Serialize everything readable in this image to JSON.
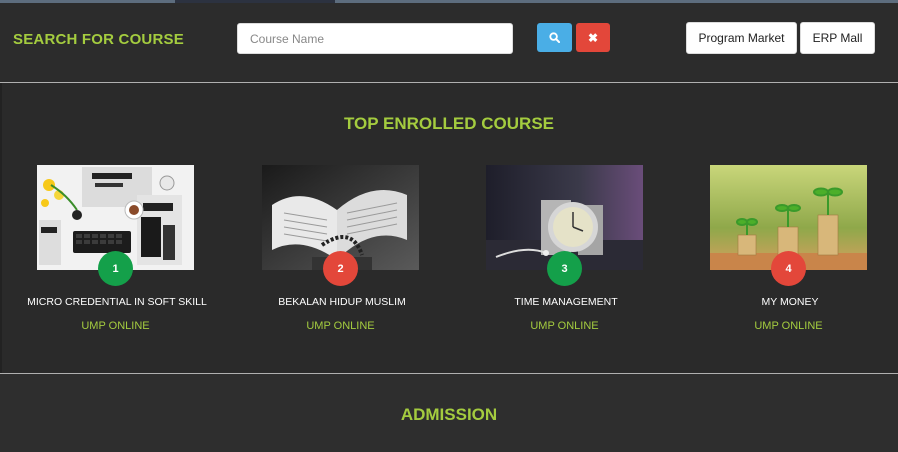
{
  "search": {
    "title": "SEARCH FOR COURSE",
    "placeholder": "Course Name",
    "search_icon": "search-icon",
    "clear_icon": "close-icon",
    "clear_glyph": "✖"
  },
  "header_links": {
    "program_market": "Program Market",
    "erp_mall": "ERP Mall"
  },
  "top_enrolled": {
    "title": "TOP ENROLLED COURSE",
    "courses": [
      {
        "rank": "1",
        "name": "MICRO CREDENTIAL IN SOFT SKILL",
        "institution": "UMP ONLINE",
        "badge_color": "#14a04a"
      },
      {
        "rank": "2",
        "name": "BEKALAN HIDUP MUSLIM",
        "institution": "UMP ONLINE",
        "badge_color": "#e3473a"
      },
      {
        "rank": "3",
        "name": "TIME MANAGEMENT",
        "institution": "UMP ONLINE",
        "badge_color": "#14a04a"
      },
      {
        "rank": "4",
        "name": "MY MONEY",
        "institution": "UMP ONLINE",
        "badge_color": "#e3473a"
      }
    ]
  },
  "admission": {
    "title": "ADMISSION"
  },
  "colors": {
    "accent": "#a4cc3f",
    "background": "#2a2a2a",
    "search_button": "#4aaee6",
    "clear_button": "#e3473a"
  }
}
